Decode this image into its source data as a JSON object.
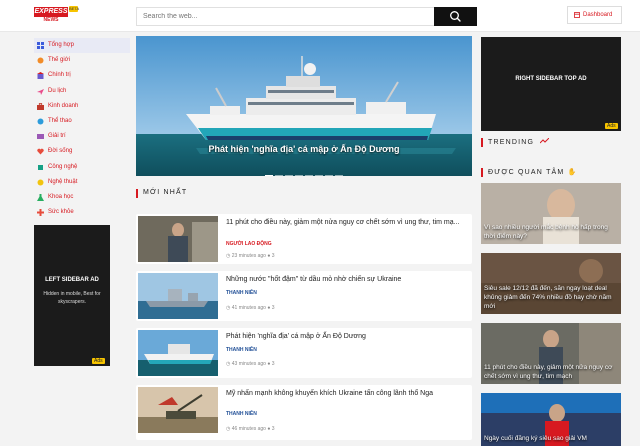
{
  "header": {
    "logo_text": "EXPRESS",
    "logo_sub": "NEWS",
    "logo_badge": "BETA",
    "search_placeholder": "Search the web...",
    "dashboard_label": "Dashboard"
  },
  "sidebar": {
    "items": [
      {
        "label": "Tổng hợp",
        "icon": "grid-icon",
        "active": true
      },
      {
        "label": "Thế giới",
        "icon": "globe-icon"
      },
      {
        "label": "Chính trị",
        "icon": "building-icon"
      },
      {
        "label": "Du lịch",
        "icon": "plane-icon"
      },
      {
        "label": "Kinh doanh",
        "icon": "briefcase-icon"
      },
      {
        "label": "Thể thao",
        "icon": "ball-icon"
      },
      {
        "label": "Giải trí",
        "icon": "film-icon"
      },
      {
        "label": "Đời sống",
        "icon": "heart-icon"
      },
      {
        "label": "Công nghệ",
        "icon": "chip-icon"
      },
      {
        "label": "Nghệ thuật",
        "icon": "palette-icon"
      },
      {
        "label": "Khoa học",
        "icon": "flask-icon"
      },
      {
        "label": "Sức khỏe",
        "icon": "cross-icon"
      }
    ],
    "ad": {
      "title": "LEFT SIDEBAR AD",
      "subtitle": "Hidden in mobile, Best for skyscrapers.",
      "tag": "Ads"
    }
  },
  "hero": {
    "caption": "Phát hiện 'nghĩa địa' cá mập ở Ấn Độ Dương",
    "dots": 8,
    "active_dot": 0
  },
  "latest": {
    "title": "MỚI NHẤT",
    "items": [
      {
        "title": "11 phút cho điều này, giảm một nửa nguy cơ chết sớm vì ung thư, tim mạ...",
        "source": "NGƯỜI LAO ĐỘNG",
        "time": "23 minutes ago",
        "count": "3"
      },
      {
        "title": "Những nước \"hốt đậm\" từ dầu mỏ nhờ chiến sự Ukraine",
        "source": "THANH NIÊN",
        "time": "41 minutes ago",
        "count": "3"
      },
      {
        "title": "Phát hiện 'nghĩa địa' cá mập ở Ấn Độ Dương",
        "source": "THANH NIÊN",
        "time": "43 minutes ago",
        "count": "3"
      },
      {
        "title": "Mỹ nhấn mạnh không khuyến khích Ukraine tấn công lãnh thổ Nga",
        "source": "THANH NIÊN",
        "time": "46 minutes ago",
        "count": "3"
      }
    ]
  },
  "right": {
    "ad_title": "RIGHT SIDEBAR TOP AD",
    "ad_tag": "Ads",
    "trending_title": "TRENDING",
    "popular_title": "ĐƯỢC QUAN TÂM",
    "popular": [
      "Vì sao nhiều người mắc bệnh hô hấp trong thời điểm này?",
      "Siêu sale 12/12 đã đến, săn ngay loạt deal khủng giảm đến 74% nhiều đồ hay chờ năm mới",
      "11 phút cho điều này, giảm một nửa nguy cơ chết sớm vì ung thư, tim mạch",
      "Ngày cuối đăng ký siêu sao giải VM"
    ]
  },
  "colors": {
    "brand_red": "#d71920",
    "ad_bg": "#1b1b1b",
    "ad_tag": "#f7c400"
  }
}
